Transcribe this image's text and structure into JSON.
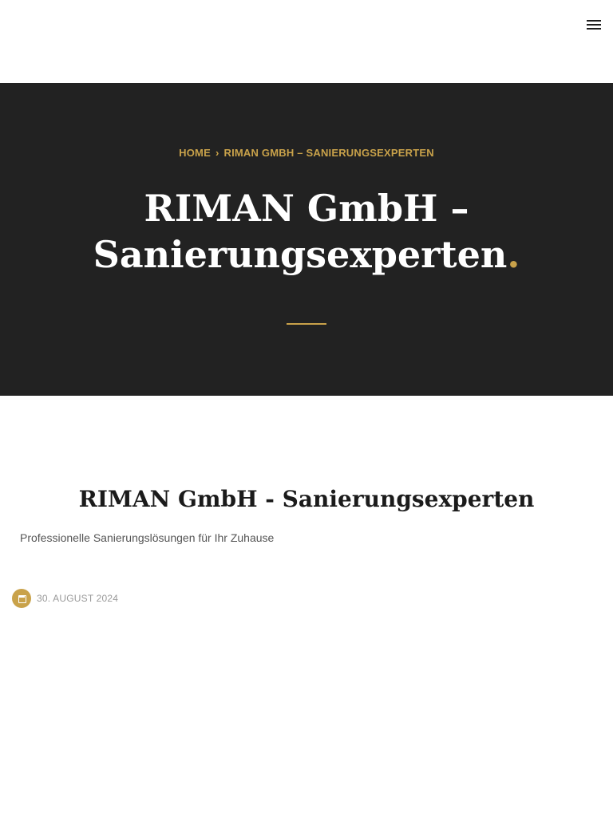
{
  "header": {
    "menu_icon": "hamburger-menu-icon"
  },
  "hero": {
    "breadcrumb": {
      "home": "HOME",
      "separator": "›",
      "current": "RIMAN GMBH – SANIERUNGSEXPERTEN"
    },
    "title": "RIMAN GmbH – Sanierungsexperten",
    "title_suffix": ".",
    "accent_color": "#c9a24a",
    "background_color": "#222222"
  },
  "post": {
    "title": "RIMAN GmbH - Sanierungsexperten",
    "subtitle": "Professionelle Sanierungslösungen für Ihr Zuhause",
    "date": "30. AUGUST 2024",
    "date_icon": "calendar-icon"
  }
}
